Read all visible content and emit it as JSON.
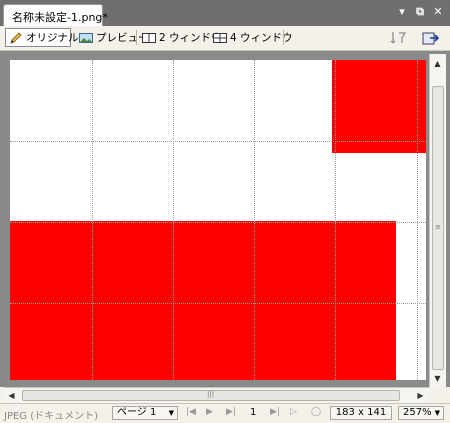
{
  "document_tab": {
    "title": "名称未設定-1.png*"
  },
  "window_controls": {
    "menu": "▾",
    "restore": "⧉",
    "close": "✕"
  },
  "view_tabs": [
    {
      "label": "オリジナル",
      "icon": "pencil-icon"
    },
    {
      "label": "プレビュー",
      "icon": "image-preview-icon"
    },
    {
      "label": "2 ウィンドウ",
      "icon": "two-window-icon"
    },
    {
      "label": "4 ウィンドウ",
      "icon": "four-window-icon"
    }
  ],
  "status": {
    "format": "JPEG (ドキュメント)",
    "page": "ページ 1",
    "frame": "1",
    "size": "183 x 141",
    "zoom": "257%"
  },
  "colors": {
    "fill": "#ff0000",
    "panel": "#f3f1e9",
    "frame": "#8a8a8a"
  }
}
